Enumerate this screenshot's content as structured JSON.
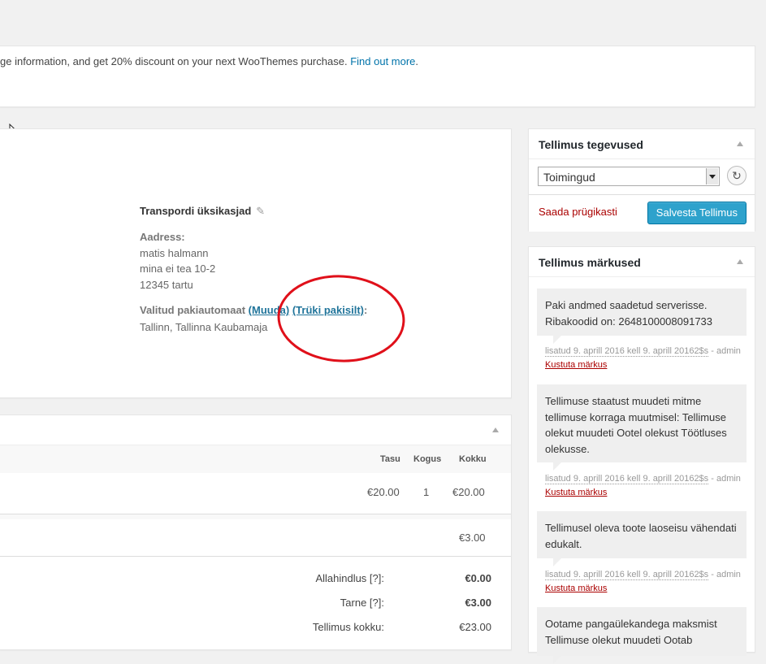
{
  "notice": {
    "text": "ge information, and get 20% discount on your next WooThemes purchase.",
    "link": "Find out more",
    "tail": "."
  },
  "order_data": {
    "shipping_title": "Transpordi üksikasjad",
    "address_label": "Aadress:",
    "address_lines": [
      "matis halmann",
      "mina ei tea 10-2",
      "12345 tartu"
    ],
    "terminal_label": "Valitud pakiautomaat",
    "change_link": "(Muuda)",
    "print_link": "(Trüki pakisilt)",
    "terminal_colon": ":",
    "terminal_value": "Tallinn, Tallinna Kaubamaja"
  },
  "items": {
    "columns": {
      "cost": "Tasu",
      "qty": "Kogus",
      "total": "Kokku"
    },
    "row": {
      "cost": "€20.00",
      "qty": "1",
      "total": "€20.00"
    },
    "shipping_total": "€3.00",
    "totals": [
      {
        "label": "Allahindlus [?]:",
        "value": "€0.00"
      },
      {
        "label": "Tarne [?]:",
        "value": "€3.00"
      },
      {
        "label": "Tellimus kokku:",
        "value": "€23.00"
      }
    ]
  },
  "actions": {
    "title": "Tellimus tegevused",
    "select_value": "Toimingud",
    "trash": "Saada prügikasti",
    "save": "Salvesta Tellimus"
  },
  "notes": {
    "title": "Tellimus märkused",
    "items": [
      {
        "text": "Paki andmed saadetud serverisse. Ribakoodid on: 2648100008091733",
        "date": "lisatud 9. aprill 2016 kell 9. aprill 20162$s",
        "by": " - admin ",
        "delete": "Kustuta märkus"
      },
      {
        "text": "Tellimuse staatust muudeti mitme tellimuse korraga muutmisel: Tellimuse olekut muudeti Ootel olekust Töötluses olekusse.",
        "date": "lisatud 9. aprill 2016 kell 9. aprill 20162$s",
        "by": " - admin ",
        "delete": "Kustuta märkus"
      },
      {
        "text": "Tellimusel oleva toote laoseisu vähendati edukalt.",
        "date": "lisatud 9. aprill 2016 kell 9. aprill 20162$s",
        "by": " - admin ",
        "delete": "Kustuta märkus"
      },
      {
        "text": "Ootame pangaülekandega maksmist Tellimuse olekut muudeti Ootab"
      }
    ]
  },
  "colors": {
    "accent_button": "#2ea2cc",
    "link": "#0073aa",
    "trash": "#aa0000",
    "annotation_circle": "#e0101a"
  }
}
